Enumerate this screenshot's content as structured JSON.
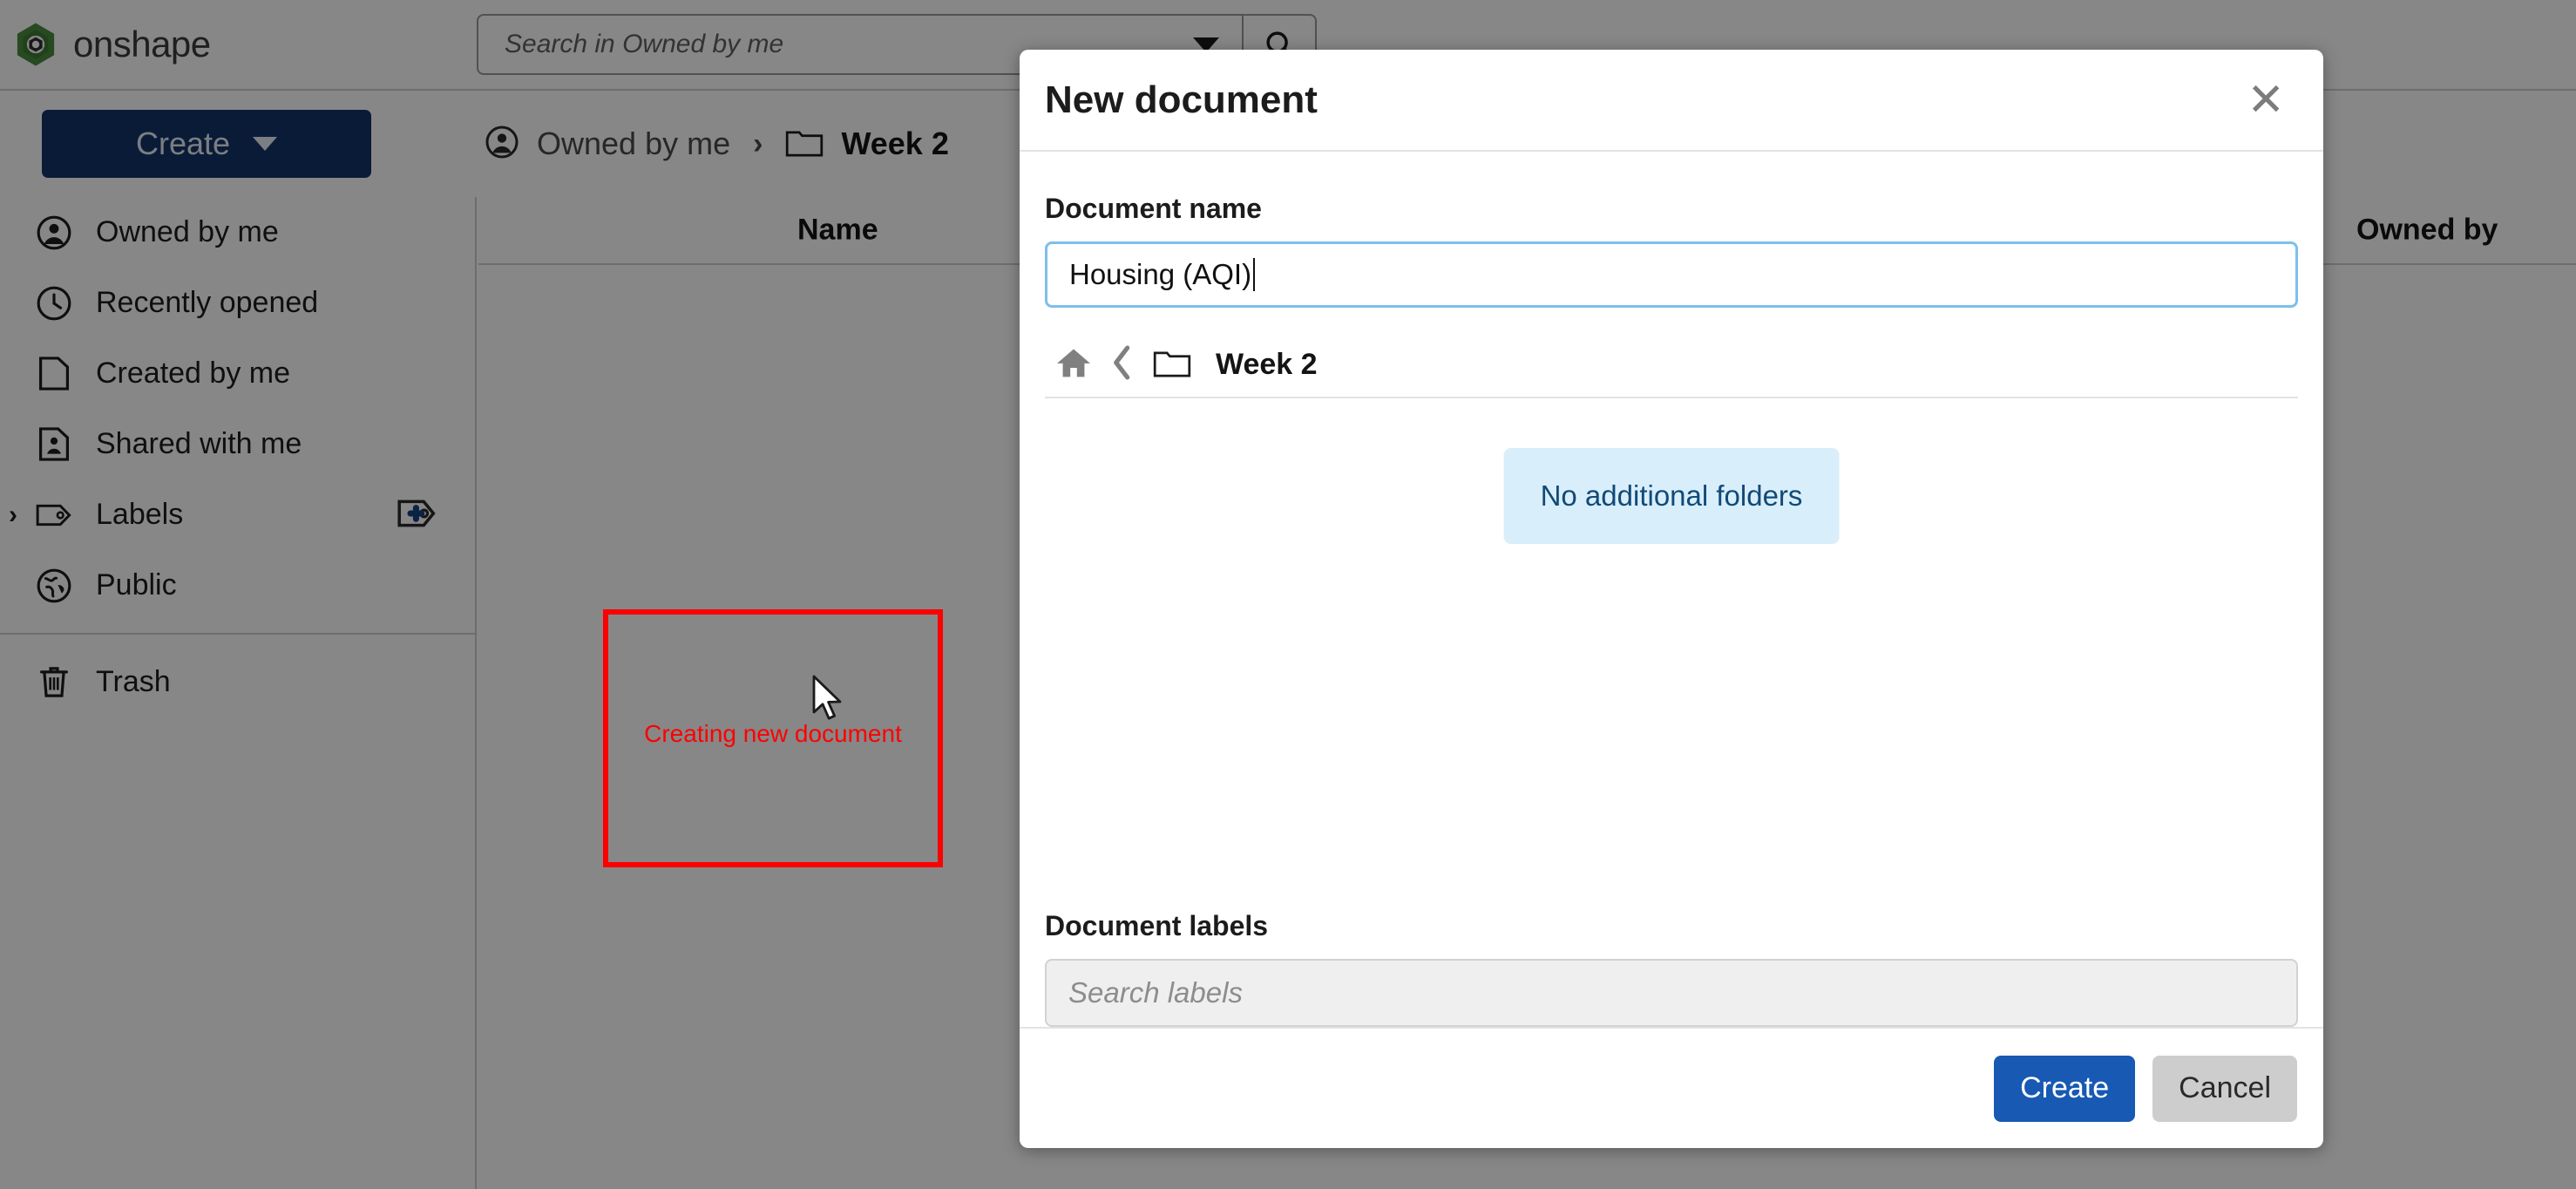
{
  "app": {
    "brand": "onshape",
    "brand_color": "#3c7d35"
  },
  "search": {
    "placeholder": "Search in Owned by me",
    "dropdown_icon": "chevron-down-icon",
    "button_icon": "search-icon"
  },
  "toolbar": {
    "create_label": "Create"
  },
  "breadcrumb": {
    "root": "Owned by me",
    "separator": "›",
    "current": "Week 2"
  },
  "sidebar": {
    "items": [
      {
        "label": "Owned by me",
        "icon": "person-circle-icon"
      },
      {
        "label": "Recently opened",
        "icon": "clock-icon"
      },
      {
        "label": "Created by me",
        "icon": "document-icon"
      },
      {
        "label": "Shared with me",
        "icon": "shared-document-icon"
      },
      {
        "label": "Labels",
        "icon": "tag-icon",
        "expand_icon": "chevron-right-icon",
        "action_icon": "add-label-icon"
      },
      {
        "label": "Public",
        "icon": "globe-icon"
      },
      {
        "label": "Trash",
        "icon": "trash-icon"
      }
    ]
  },
  "table": {
    "columns": [
      "Name",
      "Owned by"
    ]
  },
  "annotation": {
    "text": "Creating new document",
    "color": "#fe0000"
  },
  "modal": {
    "title": "New document",
    "close_icon": "close-icon",
    "name_field": {
      "label": "Document name",
      "value": "Housing (AQI)"
    },
    "folder_picker": {
      "home_icon": "home-icon",
      "back_icon": "chevron-left-icon",
      "folder_icon": "folder-icon",
      "current_folder": "Week 2",
      "empty_message": "No additional folders"
    },
    "labels_field": {
      "label": "Document labels",
      "placeholder": "Search labels"
    },
    "buttons": {
      "primary": "Create",
      "secondary": "Cancel"
    }
  }
}
